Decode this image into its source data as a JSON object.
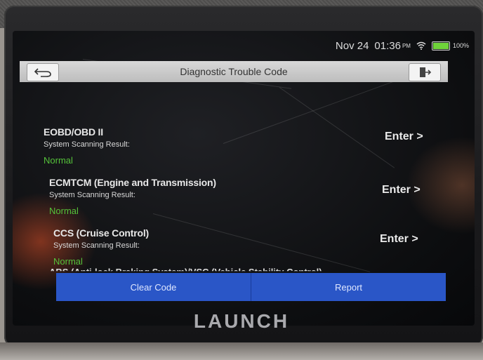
{
  "status_bar": {
    "date": "Nov 24",
    "time": "01:36",
    "ampm": "PM",
    "battery": "100%",
    "battery_color": "#6fd23a"
  },
  "header": {
    "title": "Diagnostic Trouble Code",
    "back_icon": "back-arrow-icon",
    "exit_icon": "exit-icon"
  },
  "systems": [
    {
      "name": "EOBD/OBD II",
      "label": "System Scanning Result:",
      "result": "Normal",
      "action": "Enter >"
    },
    {
      "name": "ECMTCM (Engine and Transmission)",
      "label": "System Scanning Result:",
      "result": "Normal",
      "action": "Enter >"
    },
    {
      "name": "CCS (Cruise Control)",
      "label": "System Scanning Result:",
      "result": "Normal",
      "action": "Enter >"
    },
    {
      "name": "ABS (Anti-lock Braking System)/VSC (Vehicle Stability Control)",
      "label": "",
      "result": "",
      "action": ""
    }
  ],
  "actions": {
    "clear_code": "Clear Code",
    "report": "Report",
    "button_color": "#2a56c7"
  },
  "brand": "LAUNCH",
  "colors": {
    "normal_status": "#55c23a",
    "titlebar": "#d0d0d0"
  }
}
